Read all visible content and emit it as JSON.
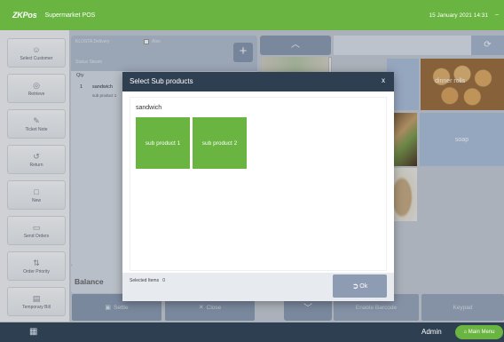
{
  "topbar": {
    "logo": "ZKPos",
    "title": "Supermarket POS",
    "datetime": "15 January 2021 14:31",
    "menu_icon": "minus-icon"
  },
  "sidebar": {
    "items": [
      {
        "label": "Select Customer",
        "icon": "person-icon"
      },
      {
        "label": "Retrieve",
        "icon": "retrieve-icon"
      },
      {
        "label": "Ticket Note",
        "icon": "note-icon"
      },
      {
        "label": "Return",
        "icon": "return-icon"
      },
      {
        "label": "New",
        "icon": "new-icon"
      },
      {
        "label": "Send Orders",
        "icon": "send-icon"
      },
      {
        "label": "Order Priority",
        "icon": "priority-icon"
      },
      {
        "label": "Temporary Bill",
        "icon": "bill-icon"
      }
    ]
  },
  "order": {
    "header_label": "KLOSTA Delivery",
    "also_label": "Also",
    "status_label": "Status   Steam",
    "qty_header": "Qty",
    "item": {
      "qty": "1",
      "name": "sandwich",
      "sub": "sub product 1"
    },
    "balance_label": "Balance"
  },
  "products": {
    "rolls_label": "dinner rolls",
    "soap_label": "soap"
  },
  "actions": {
    "settle": "Settle",
    "close": "Close",
    "enable_barcode": "Enable Barcode",
    "keypad": "Keypad"
  },
  "bottombar": {
    "user": "Admin",
    "main_menu": "Main Menu"
  },
  "modal": {
    "title": "Select Sub products",
    "close": "x",
    "group_name": "sandwich",
    "sub_products": [
      "sub product 1",
      "sub product 2"
    ],
    "selected_label": "Selected Items",
    "selected_count": "0",
    "ok_label": "Ok"
  },
  "colors": {
    "accent_green": "#6ab442",
    "header_dark": "#2f3f52",
    "button_slate": "#8d9bb3"
  }
}
